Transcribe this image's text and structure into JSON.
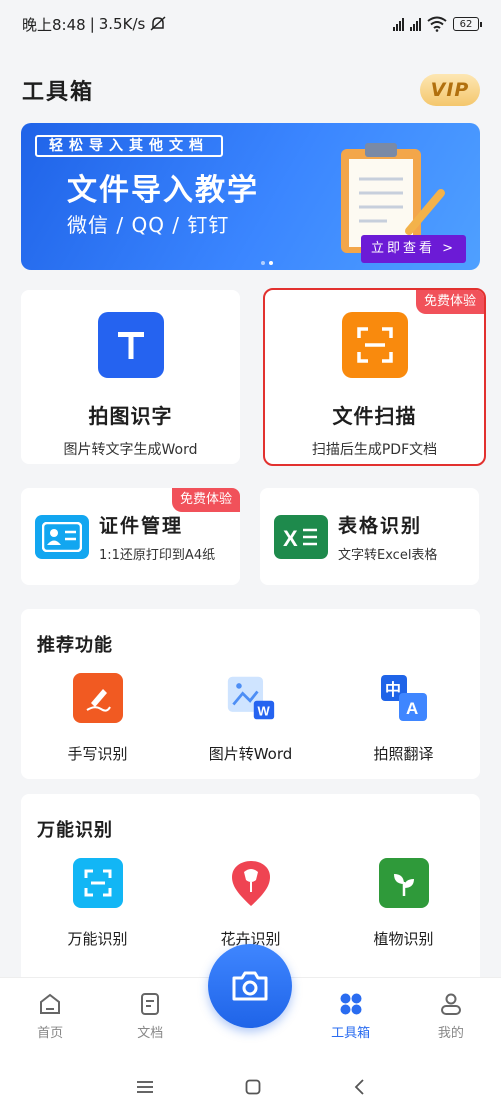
{
  "status_bar": {
    "time": "晚上8:48",
    "separator": "|",
    "speed": "3.5K/s",
    "battery": "62"
  },
  "header": {
    "title": "工具箱",
    "vip": "VIP"
  },
  "banner": {
    "tag": "轻松导入其他文档",
    "title": "文件导入教学",
    "subtitle": "微信 / QQ / 钉钉",
    "cta": "立即查看 >"
  },
  "big_cards": [
    {
      "title": "拍图识字",
      "subtitle": "图片转文字生成Word",
      "tag": ""
    },
    {
      "title": "文件扫描",
      "subtitle": "扫描后生成PDF文档",
      "tag": "免费体验"
    }
  ],
  "small_cards": [
    {
      "title": "证件管理",
      "subtitle": "1:1还原打印到A4纸",
      "tag": "免费体验"
    },
    {
      "title": "表格识别",
      "subtitle": "文字转Excel表格"
    }
  ],
  "recommended": {
    "title": "推荐功能",
    "items": [
      {
        "label": "手写识别"
      },
      {
        "label": "图片转Word"
      },
      {
        "label": "拍照翻译"
      }
    ]
  },
  "universal": {
    "title": "万能识别",
    "items": [
      {
        "label": "万能识别"
      },
      {
        "label": "花卉识别"
      },
      {
        "label": "植物识别"
      }
    ]
  },
  "bottom_nav": {
    "items": [
      {
        "label": "首页"
      },
      {
        "label": "文档"
      },
      {
        "label": ""
      },
      {
        "label": "工具箱"
      },
      {
        "label": "我的"
      }
    ],
    "active": "工具箱"
  },
  "colors": {
    "accent": "#2a6cf0",
    "free_tag": "#f1515a",
    "highlight": "#e2312f"
  }
}
